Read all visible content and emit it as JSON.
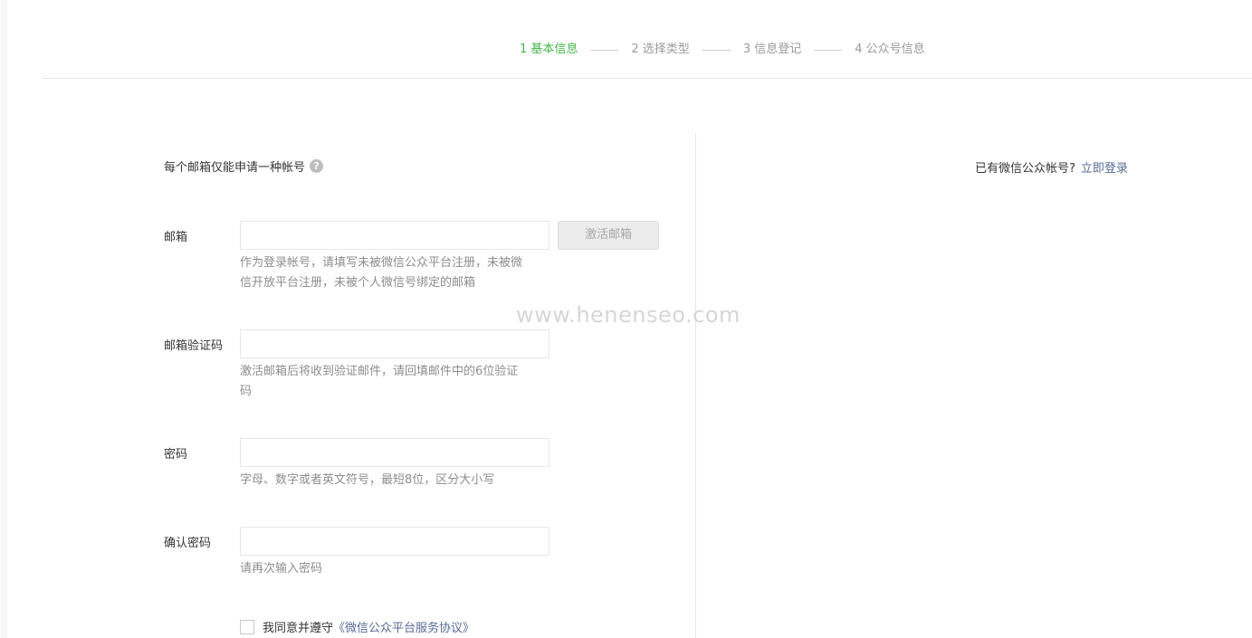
{
  "steps": [
    {
      "label": "1 基本信息",
      "active": true
    },
    {
      "label": "2 选择类型",
      "active": false
    },
    {
      "label": "3 信息登记",
      "active": false
    },
    {
      "label": "4 公众号信息",
      "active": false
    }
  ],
  "notice": {
    "text": "每个邮箱仅能申请一种帐号",
    "help_glyph": "?"
  },
  "login_hint": {
    "text": "已有微信公众帐号?",
    "link": "立即登录"
  },
  "form": {
    "email": {
      "label": "邮箱",
      "value": "",
      "tip": "作为登录帐号，请填写未被微信公众平台注册，未被微信开放平台注册，未被个人微信号绑定的邮箱",
      "activate_button": "激活邮箱"
    },
    "code": {
      "label": "邮箱验证码",
      "value": "",
      "tip": "激活邮箱后将收到验证邮件，请回填邮件中的6位验证码"
    },
    "password": {
      "label": "密码",
      "value": "",
      "tip": "字母、数字或者英文符号，最短8位，区分大小写"
    },
    "confirm_password": {
      "label": "确认密码",
      "value": "",
      "tip": "请再次输入密码"
    },
    "agreement": {
      "checked": false,
      "text": "我同意并遵守",
      "link": "《微信公众平台服务协议》"
    }
  },
  "watermark": "www.henenseo.com",
  "colors": {
    "active_step": "#44b549",
    "link": "#576b95",
    "tip": "#8d8d8d",
    "border": "#e7e7eb"
  }
}
